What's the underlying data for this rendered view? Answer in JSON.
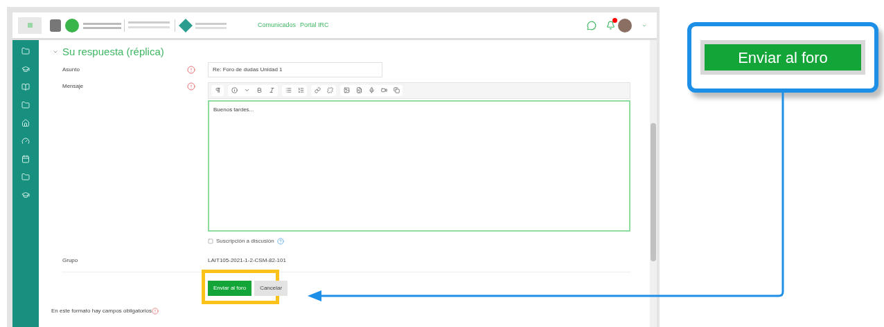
{
  "header": {
    "links": [
      "Comunicados",
      "Portal IRC"
    ],
    "has_notifications": true
  },
  "form": {
    "section_title": "Su respuesta (réplica)",
    "section_expanded": true,
    "fields": [
      {
        "kind": "text",
        "label": "Asunto",
        "required": true,
        "value": "Re: Foro de dudas Unidad 1"
      },
      {
        "kind": "editor",
        "label": "Mensaje",
        "required": true,
        "value": "Buenos tardes..."
      },
      {
        "kind": "checkbox",
        "label": "Suscripción a discusión",
        "checked": false
      },
      {
        "kind": "static",
        "label": "Grupo",
        "value": "LAIT105-2021-1-2-CSM-82-101"
      }
    ],
    "buttons": [
      {
        "kind": "submit",
        "label": "Enviar al foro",
        "highlighted": true
      },
      {
        "kind": "cancel",
        "label": "Cancelar",
        "highlighted": false
      }
    ],
    "footnote": "En este formato hay campos obligatorios"
  },
  "callout": {
    "button_label": "Enviar al foro"
  }
}
